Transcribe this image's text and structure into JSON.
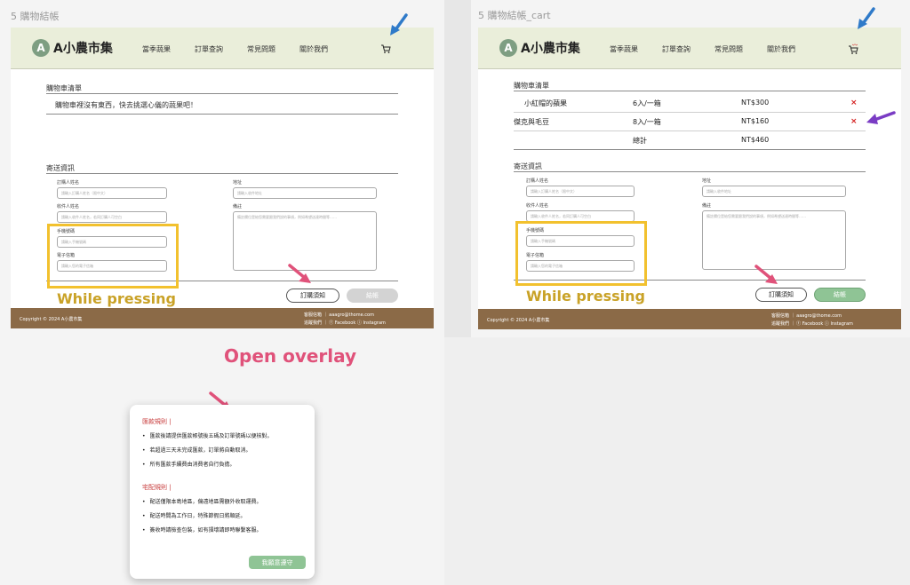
{
  "frames": {
    "left_label": "5 購物結帳",
    "right_label": "5 購物結帳_cart"
  },
  "site": {
    "logo_badge": "A",
    "logo_text": "A小農市集",
    "nav": [
      "當季蔬果",
      "訂單查詢",
      "常見問題",
      "關於我們"
    ]
  },
  "cart": {
    "title": "購物車清單",
    "empty_message": "購物車裡沒有東西，快去挑選心儀的蔬果吧！",
    "items": [
      {
        "name": "小紅帽的蘋果",
        "qty": "6入/一箱",
        "price": "NT$300",
        "remove": "×"
      },
      {
        "name": "傑克與毛豆",
        "qty": "8入/一箱",
        "price": "NT$160",
        "remove": "×"
      }
    ],
    "total_label": "總計",
    "total_value": "NT$460"
  },
  "shipping": {
    "title": "寄送資訊",
    "orderer_label": "訂購人姓名",
    "orderer_placeholder": "請輸入訂購人姓名（限中文）",
    "recipient_label": "收件人姓名",
    "recipient_placeholder": "請輸入收件人姓名，若同訂購人可空白",
    "phone_label": "手機號碼",
    "phone_placeholder": "請輸入手機號碼",
    "email_label": "電子信箱",
    "email_placeholder": "請輸入您的電子信箱",
    "address_label": "地址",
    "address_placeholder": "請輸入收件地址",
    "note_label": "備註",
    "note_placeholder": "備註欄位是給您需要跟我們說的事項，例如希望送達時間等……"
  },
  "annotations": {
    "while_pressing": "While pressing",
    "open_overlay": "Open overlay"
  },
  "buttons": {
    "notice": "訂購須知",
    "checkout": "結帳"
  },
  "footer": {
    "copyright": "Copyright © 2024 A小農市集",
    "contact": "客服信箱 ｜ aaagro@thome.com",
    "follow": "追蹤我們 ｜ ⓕ Facebook  ⓘ Instagram"
  },
  "modal": {
    "payment_title": "匯款規則 |",
    "payment_rules": [
      "匯款後請提供匯款帳號後五碼及訂單號碼以便核對。",
      "若超過三天未完成匯款，訂單將自動取消。",
      "所有匯款手續費由消費者自行負擔。"
    ],
    "delivery_title": "宅配規則 |",
    "delivery_rules": [
      "配送僅限本島地區，偏遠地區需額外收取運費。",
      "配送時間為工作日，特殊節假日將順延。",
      "簽收時請檢查包裝，如有損壞請即時聯繫客服。"
    ],
    "confirm_button": "我願意遵守"
  },
  "colors": {
    "header_bg": "#eaeeda",
    "footer_bg": "#8b6a47",
    "highlight": "#f2c12e",
    "accent_pink": "#e0527a",
    "checkout_active": "#8fc495",
    "checkout_disabled": "#d3d3d3",
    "arrow_blue": "#2f7ac9",
    "arrow_purple": "#7a3cc4"
  }
}
